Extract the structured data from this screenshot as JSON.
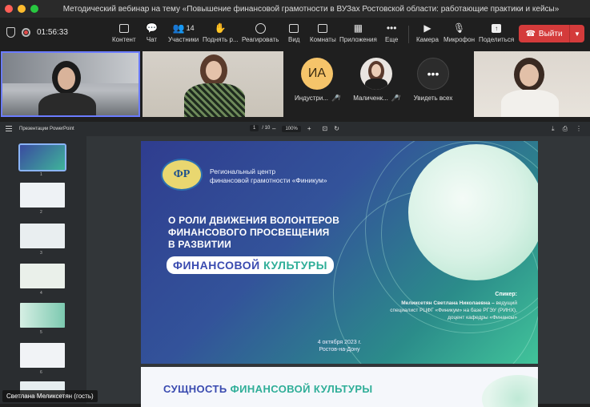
{
  "window": {
    "title": "Методический вебинар на тему «Повышение финансовой грамотности в ВУЗах Ростовской области: работающие практики и кейсы»"
  },
  "toolbar": {
    "timer": "01:56:33",
    "buttons": [
      {
        "label": "Контент",
        "icon": "share-content-icon"
      },
      {
        "label": "Чат",
        "icon": "chat-icon"
      },
      {
        "label": "Участники",
        "icon": "participants-icon",
        "count": "14"
      },
      {
        "label": "Поднять р...",
        "icon": "raise-hand-icon"
      },
      {
        "label": "Реагировать",
        "icon": "react-icon"
      },
      {
        "label": "Вид",
        "icon": "view-icon"
      },
      {
        "label": "Комнаты",
        "icon": "rooms-icon"
      },
      {
        "label": "Приложения",
        "icon": "apps-icon"
      },
      {
        "label": "Еще",
        "icon": "more-icon"
      },
      {
        "label": "Камера",
        "icon": "camera-icon"
      },
      {
        "label": "Микрофон",
        "icon": "microphone-icon"
      },
      {
        "label": "Поделиться",
        "icon": "share-icon"
      }
    ],
    "exit_label": "Выйти"
  },
  "participants": {
    "tile_ia_initials": "ИА",
    "tile_ia_name": "Индустри...",
    "tile_photo_name": "Маличенк...",
    "tile_more_label": "Увидеть всех",
    "active_speaker_name": "Светлана Меликсетян (гость)"
  },
  "viewer": {
    "doc_title": "Презентации PowerPoint",
    "page_current": "1",
    "page_total": "/ 10",
    "zoom": "100%",
    "thumbnail_numbers": [
      "1",
      "2",
      "3",
      "4",
      "5",
      "6"
    ]
  },
  "slide1": {
    "logo_letters": "ФР",
    "org_line1": "Региональный центр",
    "org_line2": "финансовой грамотности «Финикум»",
    "headline_line1": "О РОЛИ ДВИЖЕНИЯ ВОЛОНТЕРОВ",
    "headline_line2": "ФИНАНСОВОГО ПРОСВЕЩЕНИЯ",
    "headline_line3": "В РАЗВИТИИ",
    "pill_part1": "ФИНАНСОВОЙ ",
    "pill_part2": "КУЛЬТУРЫ",
    "speaker_label": "Спикер:",
    "speaker_name": "Меликсетян Светлана Николаевна –",
    "speaker_desc1": " ведущий",
    "speaker_desc2": "специалист РЦФГ «Финикум» на базе РГЭУ (РИНХ),",
    "speaker_desc3": "доцент кафедры «Финансы»",
    "date": "4 октября 2023 г.",
    "city": "Ростов-на-Дону"
  },
  "slide2": {
    "title_part1": "СУЩНОСТЬ ",
    "title_part2": "ФИНАНСОВОЙ КУЛЬТУРЫ"
  },
  "colors": {
    "exit_red": "#d43b3b",
    "selection_blue": "#6b7cff",
    "slide_blue": "#3a4bb0",
    "slide_green": "#2fae98"
  }
}
